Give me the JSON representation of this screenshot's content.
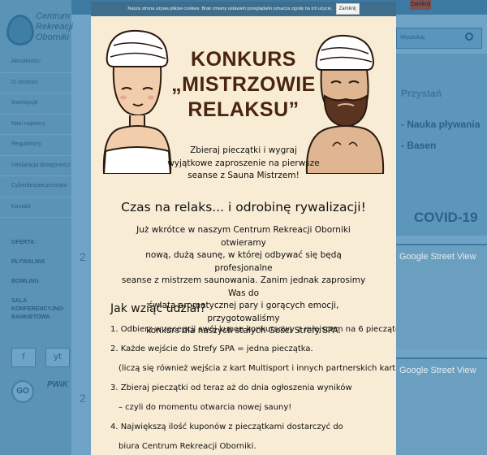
{
  "background": {
    "logo_lines": [
      "Centrum",
      "Rekreacji",
      "Oborniki"
    ],
    "nav_items": [
      "Aktualności",
      "O centrum",
      "Inwestycje",
      "Nasi najemcy",
      "Regulaminy",
      "Deklaracja dostępności",
      "Cyberbezpieczeństwo",
      "Kontakt"
    ],
    "side_links": [
      "OFERTA:",
      "PŁYWALNIA",
      "BOWLING",
      "SALA KONFERENCYJNO- BANKIETOWA"
    ],
    "social": [
      "f",
      "yt"
    ],
    "go_badge": "GO",
    "pwik_logo": "PWiK",
    "top_button": "Zamknij",
    "search_placeholder": "Wyszukaj",
    "banner_items": [
      "Przystań",
      "- Nauka pływania",
      "- Basen"
    ],
    "covid_label": "COVID-19",
    "street_view_label": "Google Street View",
    "mid_numbers": [
      "2",
      "2"
    ]
  },
  "cookie_bar": {
    "text": "Nasza strona używa plików cookies. Brak zmiany ustawień przeglądarki oznacza zgodę na ich użycie.",
    "button": "Zamknij"
  },
  "modal": {
    "title_lines": [
      "KONKURS",
      "„MISTRZOWIE",
      "RELAKSU”"
    ],
    "subtitle_lines": [
      "Zbieraj pieczątki i wygraj",
      "wyjątkowe zaproszenie na pierwsze",
      "seanse z Sauna Mistrzem!"
    ],
    "section_heading": "Czas na relaks... i odrobinę rywalizacji!",
    "intro_lines": [
      "Już wkrótce w naszym Centrum Rekreacji Oborniki otwieramy",
      "nową, dużą saunę, w której odbywać się będą profesjonalne",
      "seanse z mistrzem saunowania. Zanim jednak zaprosimy Was do",
      "świata aromatycznej pary i gorących emocji, przygotowaliśmy",
      "konkurs dla naszych stałych Gości Strefy SPA."
    ],
    "how_heading": "Jak wziąć udział?",
    "steps": [
      "1. Odbierz w recepcji swój kupon konkursowy z miejscem na 6 pieczątek.",
      "2. Każde wejście do Strefy SPA = jedna pieczątka.",
      "(liczą się również wejścia z kart Multisport i innych partnerskich kart).",
      "3. Zbieraj pieczątki od teraz aż do dnia ogłoszenia wyników",
      "– czyli do momentu otwarcia nowej sauny!",
      "4. Największą ilość kuponów z pieczątkami dostarczyć do",
      "biura Centrum Rekreacji Oborniki."
    ]
  },
  "colors": {
    "modal_bg": "#f8ecd5",
    "title_brown": "#4a2410",
    "overlay_blue": "#6fa4c6",
    "cookie_bar": "#3e6e8c"
  }
}
